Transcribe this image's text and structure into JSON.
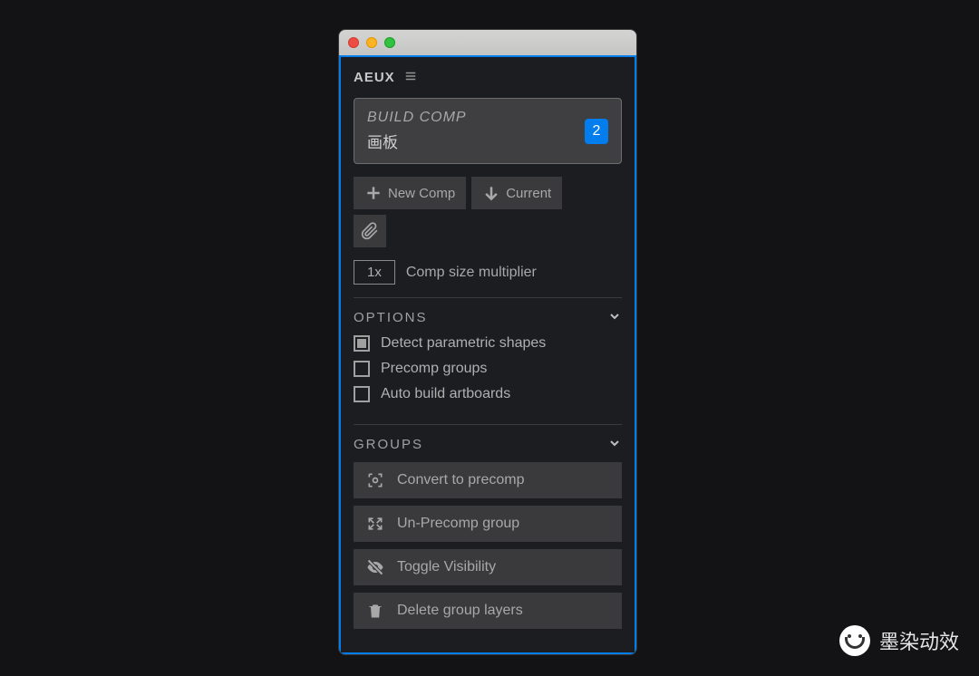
{
  "panel": {
    "title": "AEUX"
  },
  "build_comp": {
    "label": "BUILD COMP",
    "name": "画板",
    "count": "2"
  },
  "buttons": {
    "new_comp": "New Comp",
    "current": "Current"
  },
  "multiplier": {
    "value": "1x",
    "label": "Comp size multiplier"
  },
  "options": {
    "header": "OPTIONS",
    "detect_parametric": "Detect parametric shapes",
    "precomp_groups": "Precomp groups",
    "auto_build": "Auto build artboards"
  },
  "groups": {
    "header": "GROUPS",
    "convert": "Convert to precomp",
    "unprecomp": "Un-Precomp group",
    "toggle_vis": "Toggle Visibility",
    "delete": "Delete group layers"
  },
  "watermark": {
    "text": "墨染动效"
  }
}
